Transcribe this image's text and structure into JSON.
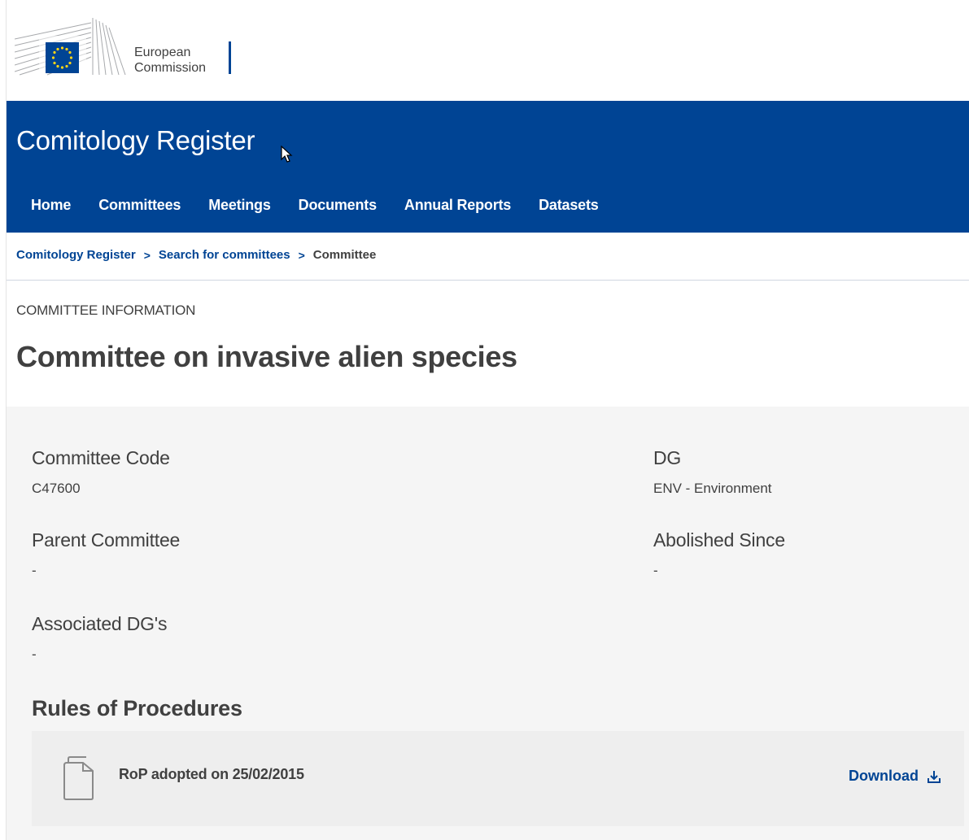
{
  "logo": {
    "line1": "European",
    "line2": "Commission"
  },
  "site_title": "Comitology Register",
  "nav": [
    {
      "label": "Home"
    },
    {
      "label": "Committees"
    },
    {
      "label": "Meetings"
    },
    {
      "label": "Documents"
    },
    {
      "label": "Annual Reports"
    },
    {
      "label": "Datasets"
    }
  ],
  "breadcrumb": {
    "items": [
      "Comitology Register",
      "Search for committees"
    ],
    "separator": ">",
    "current": "Committee"
  },
  "section_kicker": "COMMITTEE INFORMATION",
  "page_title": "Committee on invasive alien species",
  "fields": {
    "committee_code": {
      "label": "Committee Code",
      "value": "C47600"
    },
    "dg": {
      "label": "DG",
      "value": "ENV - Environment"
    },
    "parent_committee": {
      "label": "Parent Committee",
      "value": "-"
    },
    "abolished_since": {
      "label": "Abolished Since",
      "value": "-"
    },
    "associated_dgs": {
      "label": "Associated DG's",
      "value": "-"
    }
  },
  "rules": {
    "title": "Rules of Procedures",
    "document": {
      "title": "RoP adopted on 25/02/2015",
      "download_label": "Download"
    }
  },
  "colors": {
    "primary_blue": "#004494",
    "eu_yellow": "#ffd617",
    "text": "#404040",
    "panel": "#f5f5f5"
  },
  "icons": {
    "document": "document-copy-icon",
    "download": "download-icon",
    "cursor": "mouse-pointer-icon"
  }
}
